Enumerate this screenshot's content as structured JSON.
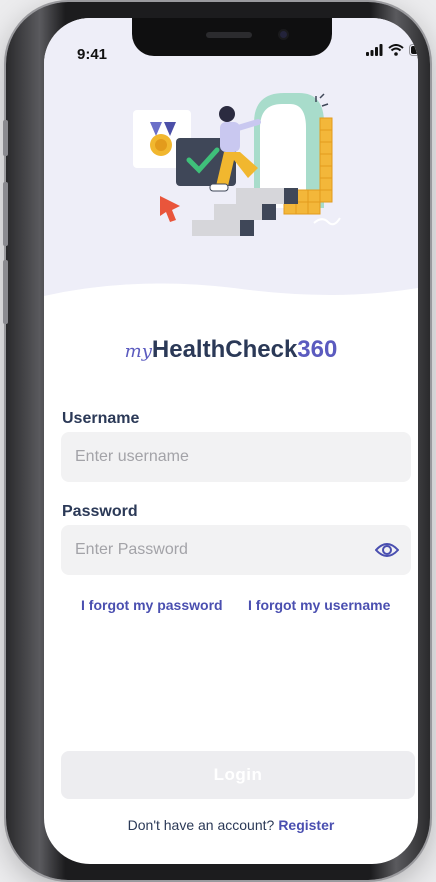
{
  "status_bar": {
    "time": "9:41"
  },
  "logo": {
    "prefix": "my",
    "name": "HealthCheck",
    "suffix": "360"
  },
  "form": {
    "username_label": "Username",
    "username_placeholder": "Enter username",
    "password_label": "Password",
    "password_placeholder": "Enter Password",
    "forgot_password": "I forgot my password",
    "forgot_username": "I forgot my username",
    "login_label": "Login"
  },
  "footer": {
    "prompt": "Don't have an account?",
    "register": "Register"
  },
  "colors": {
    "accent": "#4a4fb0",
    "heading": "#2b3957",
    "hero_bg": "#eeeef8",
    "field_bg": "#f2f2f3"
  }
}
